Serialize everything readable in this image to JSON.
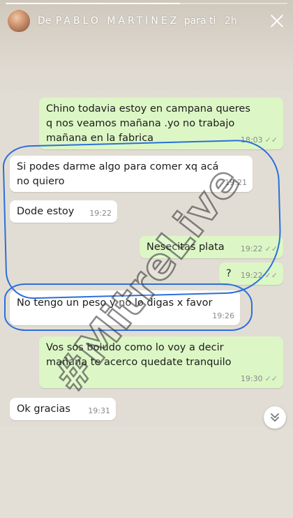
{
  "story": {
    "prefix": "De",
    "author": "PABLO MARTINEZ",
    "suffix": "para ti",
    "time_ago": "2h",
    "progress": 0.62
  },
  "messages": [
    {
      "direction": "out",
      "lines": [
        "Chino todavia estoy en campana queres",
        "q nos veamos mañana .yo no trabajo",
        "mañana en la fabrica"
      ],
      "time": "18:03",
      "ticks": "✓✓"
    },
    {
      "direction": "in",
      "lines": [
        "Si podes darme algo para comer xq acá",
        "no quiero"
      ],
      "time": "19:21"
    },
    {
      "direction": "in",
      "lines": [
        "Dode estoy"
      ],
      "time": "19:22"
    },
    {
      "direction": "out",
      "lines": [
        "Nesecitas plata"
      ],
      "time": "19:22",
      "ticks": "✓✓"
    },
    {
      "direction": "out",
      "lines": [
        "?"
      ],
      "time": "19:22",
      "ticks": "✓✓"
    },
    {
      "direction": "in",
      "lines": [
        "No tengo un peso y no lo digas x favor"
      ],
      "time": "19:26"
    },
    {
      "direction": "out",
      "lines": [
        "Vos sos boludo como lo voy a decir",
        "mañana te acerco quedate tranquilo"
      ],
      "time": "19:30",
      "ticks": "✓✓"
    },
    {
      "direction": "in",
      "lines": [
        "Ok gracias"
      ],
      "time": "19:31"
    }
  ],
  "watermark": "#MitreLive",
  "icons": {
    "close": "close-icon",
    "scroll_down": "double-chevron-down-icon"
  },
  "colors": {
    "outgoing_bubble": "#dcf7c5",
    "incoming_bubble": "#ffffff",
    "annotation": "#2a6fdb"
  }
}
